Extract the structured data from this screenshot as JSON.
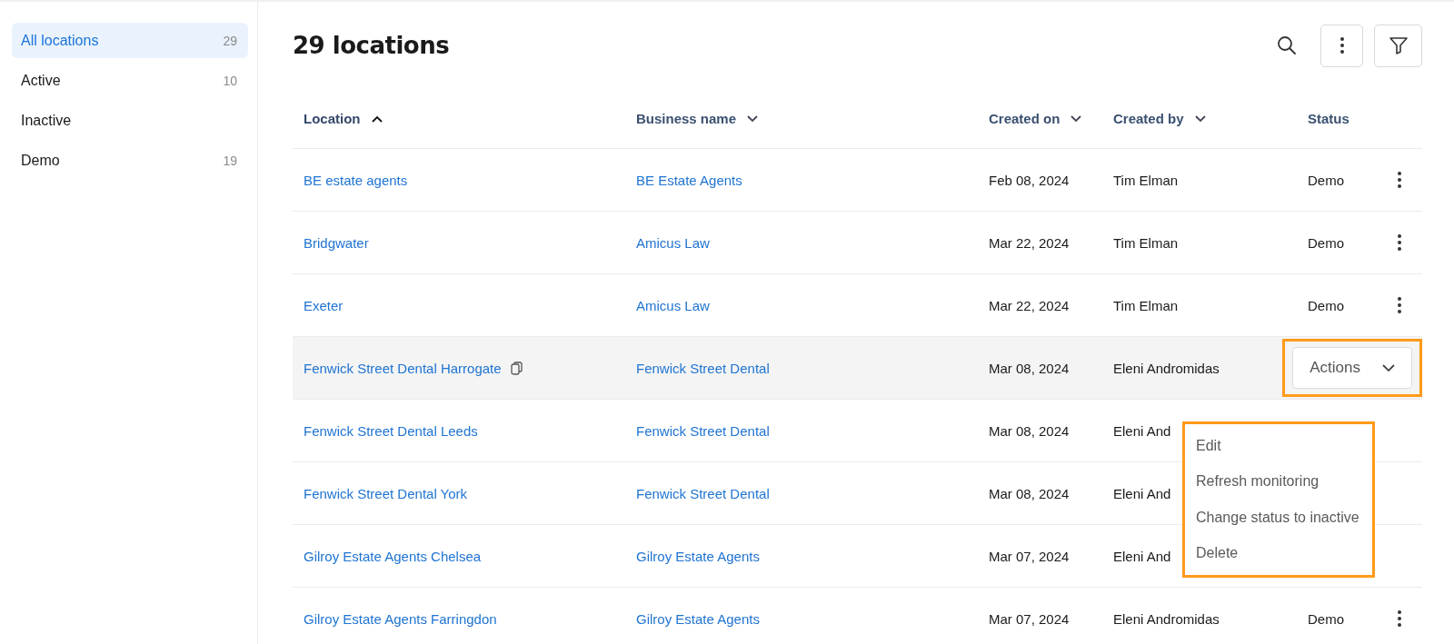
{
  "sidebar": {
    "items": [
      {
        "label": "All locations",
        "count": "29",
        "selected": true
      },
      {
        "label": "Active",
        "count": "10",
        "selected": false
      },
      {
        "label": "Inactive",
        "selected": false
      },
      {
        "label": "Demo",
        "count": "19",
        "selected": false
      }
    ]
  },
  "header": {
    "title": "29 locations"
  },
  "table": {
    "columns": [
      {
        "label": "Location",
        "sortable": true,
        "sorted": true
      },
      {
        "label": "Business name",
        "sortable": true,
        "sorted": false
      },
      {
        "label": "Created on",
        "sortable": true,
        "sorted": false
      },
      {
        "label": "Created by",
        "sortable": true,
        "sorted": false
      },
      {
        "label": "Status"
      }
    ],
    "rows": [
      {
        "location": "BE estate agents",
        "business": "BE Estate Agents",
        "created_on": "Feb 08, 2024",
        "created_by": "Tim Elman",
        "status": "Demo",
        "hovered": false
      },
      {
        "location": "Bridgwater",
        "business": "Amicus Law",
        "created_on": "Mar 22, 2024",
        "created_by": "Tim Elman",
        "status": "Demo",
        "hovered": false
      },
      {
        "location": "Exeter",
        "business": "Amicus Law",
        "created_on": "Mar 22, 2024",
        "created_by": "Tim Elman",
        "status": "Demo",
        "hovered": false
      },
      {
        "location": "Fenwick Street Dental Harrogate",
        "business": "Fenwick Street Dental",
        "created_on": "Mar 08, 2024",
        "created_by": "Eleni Andromidas",
        "hovered": true,
        "actions_label": "Actions"
      },
      {
        "location": "Fenwick Street Dental Leeds",
        "business": "Fenwick Street Dental",
        "created_on": "Mar 08, 2024",
        "created_by": "Eleni And",
        "hovered": false
      },
      {
        "location": "Fenwick Street Dental York",
        "business": "Fenwick Street Dental",
        "created_on": "Mar 08, 2024",
        "created_by": "Eleni And",
        "hovered": false
      },
      {
        "location": "Gilroy Estate Agents Chelsea",
        "business": "Gilroy Estate Agents",
        "created_on": "Mar 07, 2024",
        "created_by": "Eleni And",
        "hovered": false
      },
      {
        "location": "Gilroy Estate Agents Farringdon",
        "business": "Gilroy Estate Agents",
        "created_on": "Mar 07, 2024",
        "created_by": "Eleni Andromidas",
        "status": "Demo",
        "hovered": false
      }
    ]
  },
  "actions_menu": {
    "items": [
      "Edit",
      "Refresh monitoring",
      "Change status to inactive",
      "Delete"
    ]
  }
}
